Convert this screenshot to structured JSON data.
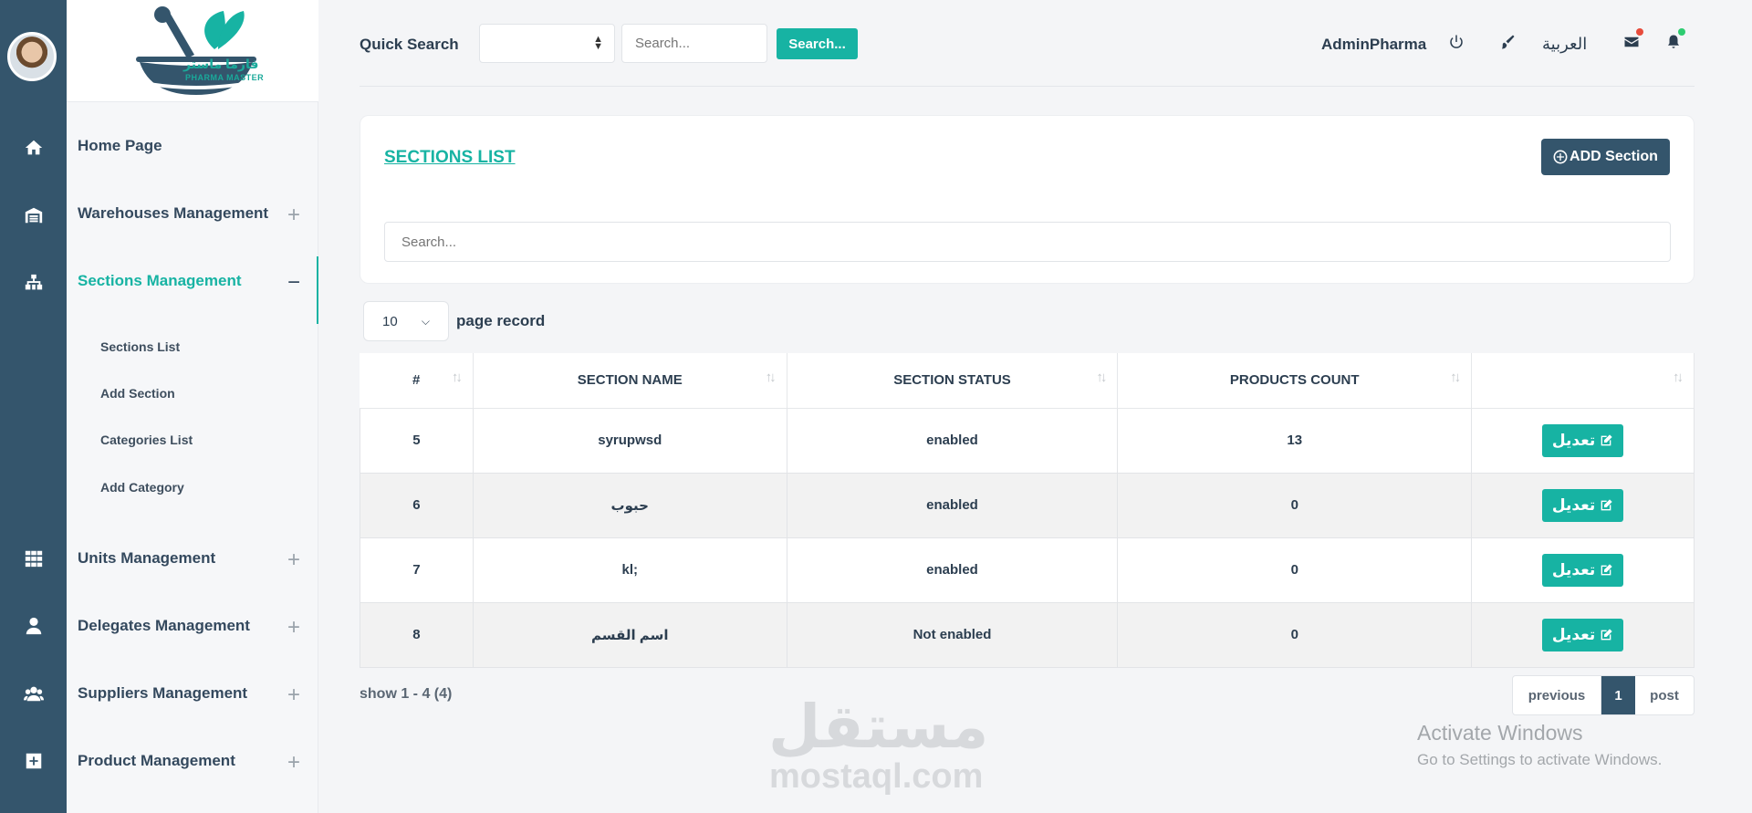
{
  "brand": {
    "name_ar": "فارما ماستر",
    "name_en": "PHARMA MASTER",
    "accent": "#17b3a3",
    "dark": "#34556c"
  },
  "rail": {
    "icons": [
      "home-icon",
      "warehouse-icon",
      "sitemap-icon",
      "grid-icon",
      "user-icon",
      "users-icon",
      "plus-square-icon"
    ]
  },
  "sidebar": {
    "items": [
      {
        "label": "Home Page"
      },
      {
        "label": "Warehouses Management",
        "toggle": "+"
      },
      {
        "label": "Sections Management",
        "toggle": "−"
      },
      {
        "label": "Units Management",
        "toggle": "+"
      },
      {
        "label": "Delegates Management",
        "toggle": "+"
      },
      {
        "label": "Suppliers Management",
        "toggle": "+"
      },
      {
        "label": "Product Management",
        "toggle": "+"
      }
    ],
    "subitems": [
      "Sections List",
      "Add Section",
      "Categories List",
      "Add Category"
    ]
  },
  "topbar": {
    "quick_search_label": "Quick Search",
    "search_placeholder": "Search...",
    "search_button": "Search...",
    "user": "AdminPharma",
    "language": "العربية",
    "icons": [
      "power-icon",
      "brush-icon",
      "envelope-icon",
      "bell-icon"
    ],
    "mail_dot_color": "#e74c3c",
    "bell_dot_color": "#2ecc71"
  },
  "card": {
    "title": "SECTIONS LIST",
    "add_button": "ADD Section",
    "search_placeholder": "Search..."
  },
  "page_size": {
    "value": "10",
    "label": "page record"
  },
  "table": {
    "headers": [
      "#",
      "SECTION NAME",
      "SECTION STATUS",
      "PRODUCTS COUNT",
      ""
    ],
    "rows": [
      {
        "id": "5",
        "name": "syrupwsd",
        "status": "enabled",
        "count": "13",
        "action": "تعديل"
      },
      {
        "id": "6",
        "name": "حبوب",
        "status": "enabled",
        "count": "0",
        "action": "تعديل"
      },
      {
        "id": "7",
        "name": "kl;",
        "status": "enabled",
        "count": "0",
        "action": "تعديل"
      },
      {
        "id": "8",
        "name": "اسم القسم",
        "status": "Not enabled",
        "count": "0",
        "action": "تعديل"
      }
    ]
  },
  "footer": {
    "showing": "show 1 - 4 (4)",
    "previous": "previous",
    "page": "1",
    "next": "post"
  },
  "overlay": {
    "watermark_ar": "مستقل",
    "watermark_en": "mostaql.com",
    "activate_title": "Activate Windows",
    "activate_sub": "Go to Settings to activate Windows."
  }
}
